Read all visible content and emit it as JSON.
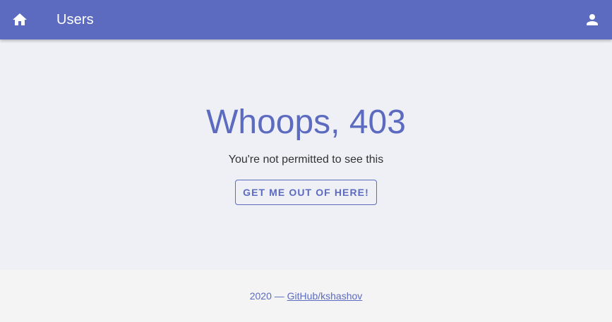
{
  "appbar": {
    "title": "Users",
    "color": "#5c6bc0",
    "home_icon": "home-icon",
    "account_icon": "account-icon"
  },
  "main": {
    "headline": "Whoops, 403",
    "message": "You're not permitted to see this",
    "button_label": "GET ME OUT OF HERE!"
  },
  "footer": {
    "year": "2020",
    "separator": "—",
    "link_text": "GitHub/kshashov"
  }
}
